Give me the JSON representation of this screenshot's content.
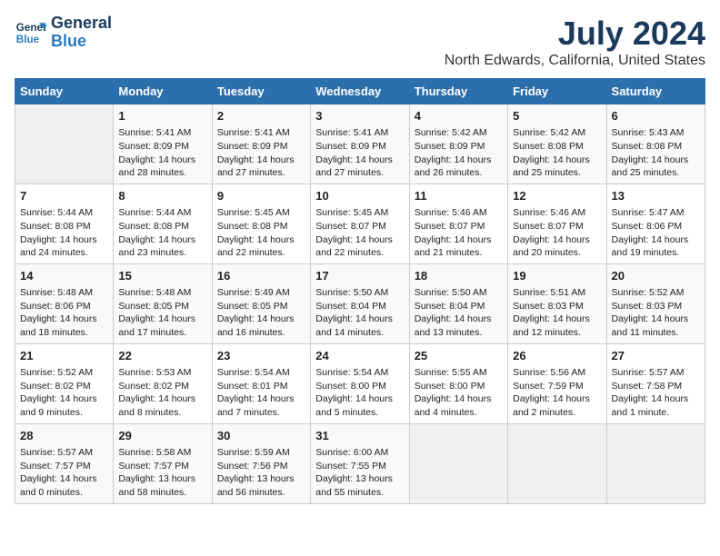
{
  "logo": {
    "line1": "General",
    "line2": "Blue"
  },
  "title": "July 2024",
  "location": "North Edwards, California, United States",
  "weekdays": [
    "Sunday",
    "Monday",
    "Tuesday",
    "Wednesday",
    "Thursday",
    "Friday",
    "Saturday"
  ],
  "weeks": [
    [
      {
        "day": "",
        "info": ""
      },
      {
        "day": "1",
        "info": "Sunrise: 5:41 AM\nSunset: 8:09 PM\nDaylight: 14 hours\nand 28 minutes."
      },
      {
        "day": "2",
        "info": "Sunrise: 5:41 AM\nSunset: 8:09 PM\nDaylight: 14 hours\nand 27 minutes."
      },
      {
        "day": "3",
        "info": "Sunrise: 5:41 AM\nSunset: 8:09 PM\nDaylight: 14 hours\nand 27 minutes."
      },
      {
        "day": "4",
        "info": "Sunrise: 5:42 AM\nSunset: 8:09 PM\nDaylight: 14 hours\nand 26 minutes."
      },
      {
        "day": "5",
        "info": "Sunrise: 5:42 AM\nSunset: 8:08 PM\nDaylight: 14 hours\nand 25 minutes."
      },
      {
        "day": "6",
        "info": "Sunrise: 5:43 AM\nSunset: 8:08 PM\nDaylight: 14 hours\nand 25 minutes."
      }
    ],
    [
      {
        "day": "7",
        "info": "Sunrise: 5:44 AM\nSunset: 8:08 PM\nDaylight: 14 hours\nand 24 minutes."
      },
      {
        "day": "8",
        "info": "Sunrise: 5:44 AM\nSunset: 8:08 PM\nDaylight: 14 hours\nand 23 minutes."
      },
      {
        "day": "9",
        "info": "Sunrise: 5:45 AM\nSunset: 8:08 PM\nDaylight: 14 hours\nand 22 minutes."
      },
      {
        "day": "10",
        "info": "Sunrise: 5:45 AM\nSunset: 8:07 PM\nDaylight: 14 hours\nand 22 minutes."
      },
      {
        "day": "11",
        "info": "Sunrise: 5:46 AM\nSunset: 8:07 PM\nDaylight: 14 hours\nand 21 minutes."
      },
      {
        "day": "12",
        "info": "Sunrise: 5:46 AM\nSunset: 8:07 PM\nDaylight: 14 hours\nand 20 minutes."
      },
      {
        "day": "13",
        "info": "Sunrise: 5:47 AM\nSunset: 8:06 PM\nDaylight: 14 hours\nand 19 minutes."
      }
    ],
    [
      {
        "day": "14",
        "info": "Sunrise: 5:48 AM\nSunset: 8:06 PM\nDaylight: 14 hours\nand 18 minutes."
      },
      {
        "day": "15",
        "info": "Sunrise: 5:48 AM\nSunset: 8:05 PM\nDaylight: 14 hours\nand 17 minutes."
      },
      {
        "day": "16",
        "info": "Sunrise: 5:49 AM\nSunset: 8:05 PM\nDaylight: 14 hours\nand 16 minutes."
      },
      {
        "day": "17",
        "info": "Sunrise: 5:50 AM\nSunset: 8:04 PM\nDaylight: 14 hours\nand 14 minutes."
      },
      {
        "day": "18",
        "info": "Sunrise: 5:50 AM\nSunset: 8:04 PM\nDaylight: 14 hours\nand 13 minutes."
      },
      {
        "day": "19",
        "info": "Sunrise: 5:51 AM\nSunset: 8:03 PM\nDaylight: 14 hours\nand 12 minutes."
      },
      {
        "day": "20",
        "info": "Sunrise: 5:52 AM\nSunset: 8:03 PM\nDaylight: 14 hours\nand 11 minutes."
      }
    ],
    [
      {
        "day": "21",
        "info": "Sunrise: 5:52 AM\nSunset: 8:02 PM\nDaylight: 14 hours\nand 9 minutes."
      },
      {
        "day": "22",
        "info": "Sunrise: 5:53 AM\nSunset: 8:02 PM\nDaylight: 14 hours\nand 8 minutes."
      },
      {
        "day": "23",
        "info": "Sunrise: 5:54 AM\nSunset: 8:01 PM\nDaylight: 14 hours\nand 7 minutes."
      },
      {
        "day": "24",
        "info": "Sunrise: 5:54 AM\nSunset: 8:00 PM\nDaylight: 14 hours\nand 5 minutes."
      },
      {
        "day": "25",
        "info": "Sunrise: 5:55 AM\nSunset: 8:00 PM\nDaylight: 14 hours\nand 4 minutes."
      },
      {
        "day": "26",
        "info": "Sunrise: 5:56 AM\nSunset: 7:59 PM\nDaylight: 14 hours\nand 2 minutes."
      },
      {
        "day": "27",
        "info": "Sunrise: 5:57 AM\nSunset: 7:58 PM\nDaylight: 14 hours\nand 1 minute."
      }
    ],
    [
      {
        "day": "28",
        "info": "Sunrise: 5:57 AM\nSunset: 7:57 PM\nDaylight: 14 hours\nand 0 minutes."
      },
      {
        "day": "29",
        "info": "Sunrise: 5:58 AM\nSunset: 7:57 PM\nDaylight: 13 hours\nand 58 minutes."
      },
      {
        "day": "30",
        "info": "Sunrise: 5:59 AM\nSunset: 7:56 PM\nDaylight: 13 hours\nand 56 minutes."
      },
      {
        "day": "31",
        "info": "Sunrise: 6:00 AM\nSunset: 7:55 PM\nDaylight: 13 hours\nand 55 minutes."
      },
      {
        "day": "",
        "info": ""
      },
      {
        "day": "",
        "info": ""
      },
      {
        "day": "",
        "info": ""
      }
    ]
  ]
}
